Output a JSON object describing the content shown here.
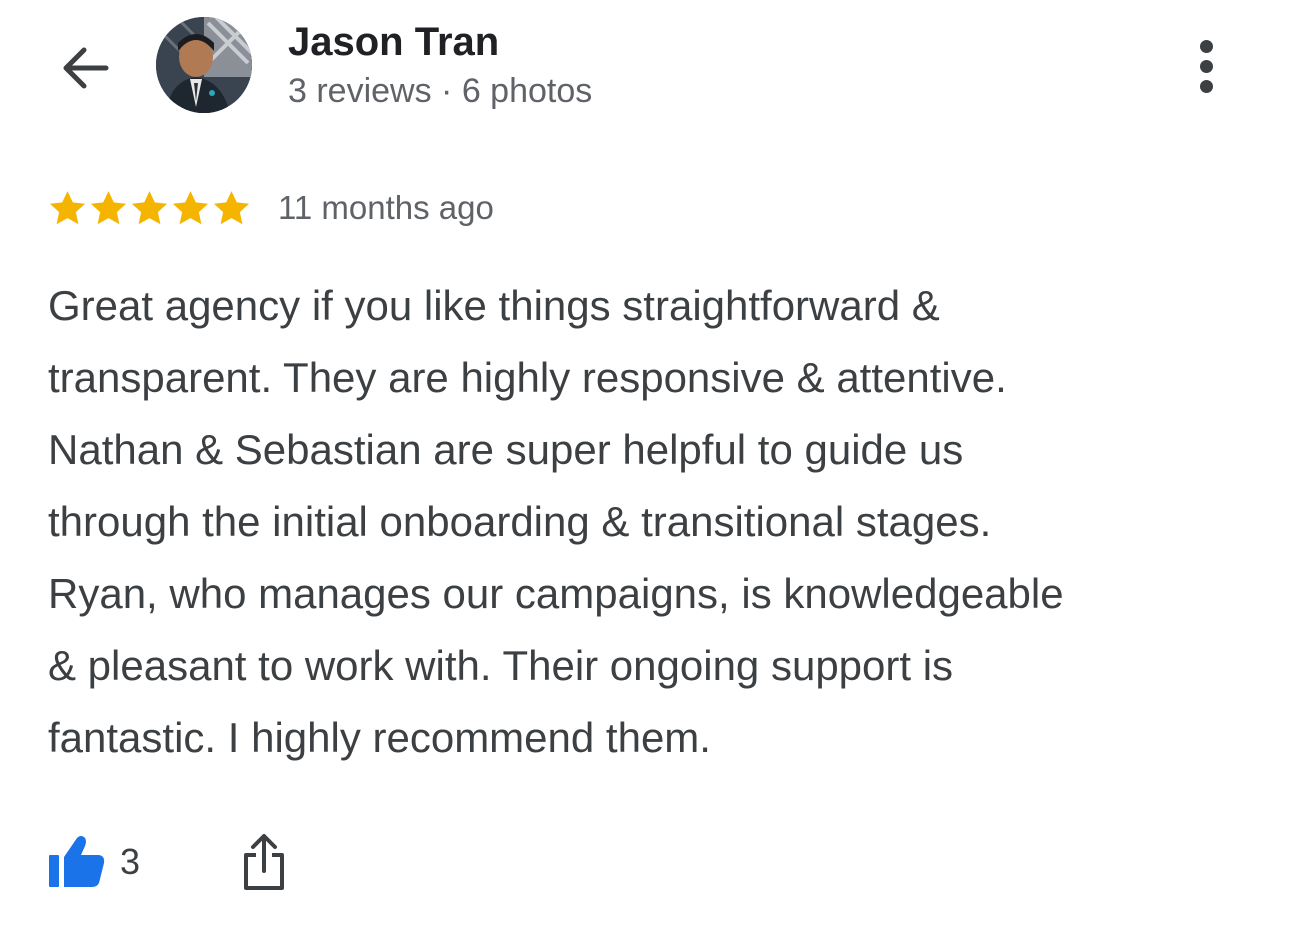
{
  "header": {
    "back_icon": "arrow-back-icon",
    "author_name": "Jason Tran",
    "author_meta": "3 reviews · 6 photos",
    "more_icon": "more-vert-icon"
  },
  "review": {
    "rating": 5,
    "rating_max": 5,
    "star_color": "#f4b400",
    "time": "11 months ago",
    "text_lines": [
      "Great agency if you like things straightforward &",
      "transparent. They are highly responsive & attentive.",
      "Nathan & Sebastian are super helpful to guide us",
      "through the initial onboarding & transitional stages.",
      "Ryan, who manages our campaigns, is knowledgeable",
      "& pleasant to work with. Their ongoing support is",
      "fantastic. I highly recommend them."
    ]
  },
  "actions": {
    "like_icon": "thumbs-up-icon",
    "like_color": "#1a73e8",
    "like_count": "3",
    "share_icon": "share-icon"
  }
}
